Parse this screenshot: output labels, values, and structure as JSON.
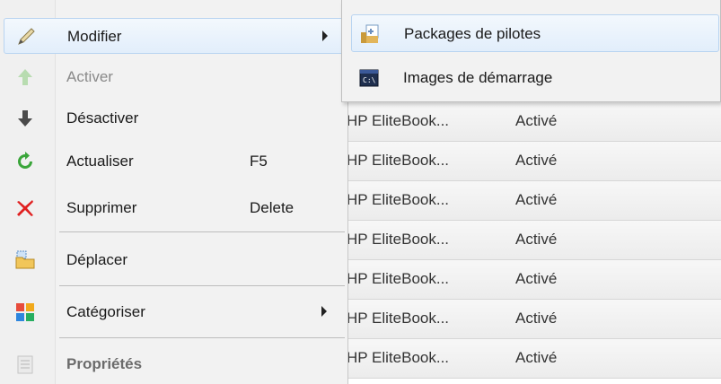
{
  "background_list": {
    "rows": [
      {
        "name": "HP EliteBook...",
        "status": "Activé"
      },
      {
        "name": "HP EliteBook...",
        "status": "Activé"
      },
      {
        "name": "HP EliteBook...",
        "status": "Activé"
      },
      {
        "name": "HP EliteBook...",
        "status": "Activé"
      },
      {
        "name": "HP EliteBook...",
        "status": "Activé"
      },
      {
        "name": "HP EliteBook...",
        "status": "Activé"
      },
      {
        "name": "HP EliteBook...",
        "status": "Activé"
      }
    ]
  },
  "menu": {
    "items": [
      {
        "label": "Modifier",
        "icon": "pencil-icon",
        "submenu": true,
        "state": "hover"
      },
      {
        "label": "Activer",
        "icon": "arrow-up-icon",
        "state": "disabled"
      },
      {
        "label": "Désactiver",
        "icon": "arrow-down-icon"
      },
      {
        "label": "Actualiser",
        "icon": "refresh-icon",
        "shortcut": "F5"
      },
      {
        "label": "Supprimer",
        "icon": "delete-x-icon",
        "shortcut": "Delete"
      },
      {
        "label": "Déplacer",
        "icon": "folder-move-icon"
      },
      {
        "label": "Catégoriser",
        "icon": "categorize-icon",
        "submenu": true
      },
      {
        "label": "Propriétés",
        "icon": "properties-icon",
        "state": "disabled-bold"
      }
    ]
  },
  "submenu": {
    "items": [
      {
        "label": "Packages de pilotes",
        "icon": "driver-package-icon",
        "state": "hover"
      },
      {
        "label": "Images de démarrage",
        "icon": "boot-image-icon"
      }
    ]
  },
  "colors": {
    "delete_red": "#e02020",
    "refresh_green": "#3aa53a",
    "hover_border": "#b9d4f1"
  }
}
